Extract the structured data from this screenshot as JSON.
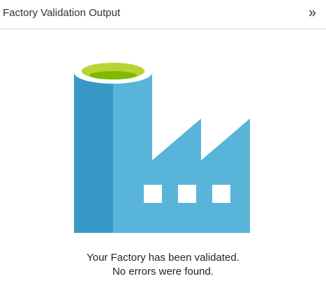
{
  "panel": {
    "title": "Factory Validation Output",
    "collapse_icon": "double-chevron-right-icon"
  },
  "illustration": {
    "icon": "data-factory-icon",
    "colors": {
      "tank_front": "#3999c6",
      "building": "#59b4d9",
      "tank_top_ring": "#b8d432",
      "tank_top_inner": "#7fba00",
      "windows": "#ffffff"
    }
  },
  "result": {
    "line1": "Your Factory has been validated.",
    "line2": "No errors were found."
  }
}
